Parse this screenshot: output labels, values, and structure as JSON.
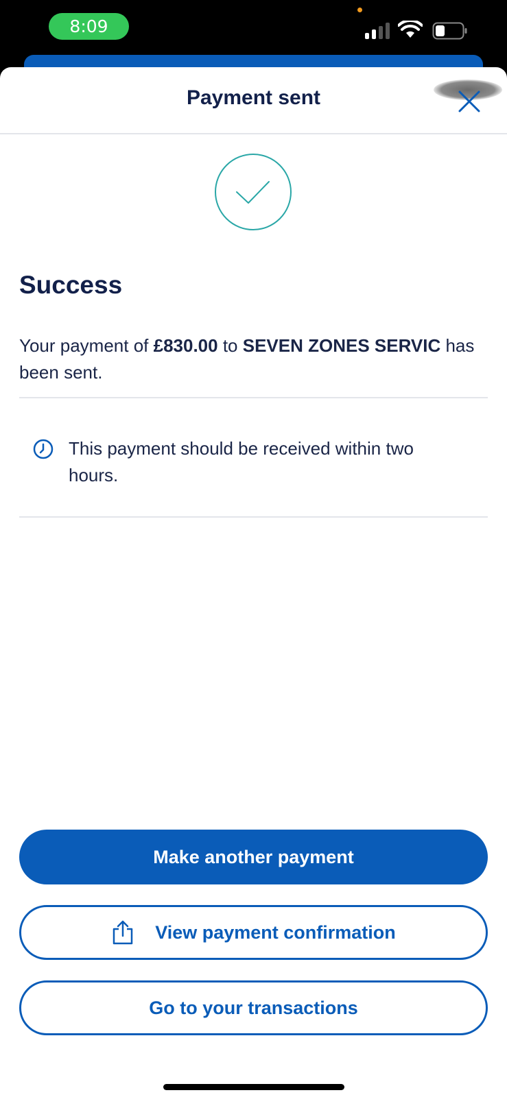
{
  "status_bar": {
    "time": "8:09"
  },
  "header": {
    "title": "Payment sent",
    "close_icon": "close-icon"
  },
  "content": {
    "heading": "Success",
    "message_prefix": "Your payment of ",
    "amount": "£830.00",
    "message_middle": " to ",
    "payee": "SEVEN ZONES SERVIC",
    "message_suffix": " has been sent.",
    "info_text": "This payment should be received within two hours."
  },
  "actions": {
    "make_another": "Make another payment",
    "view_confirmation": "View payment confirmation",
    "transactions": "Go to your transactions"
  },
  "colors": {
    "primary": "#0a5cb8",
    "text": "#12204a",
    "success_ring": "#2aa7a7",
    "time_pill": "#34c759"
  }
}
